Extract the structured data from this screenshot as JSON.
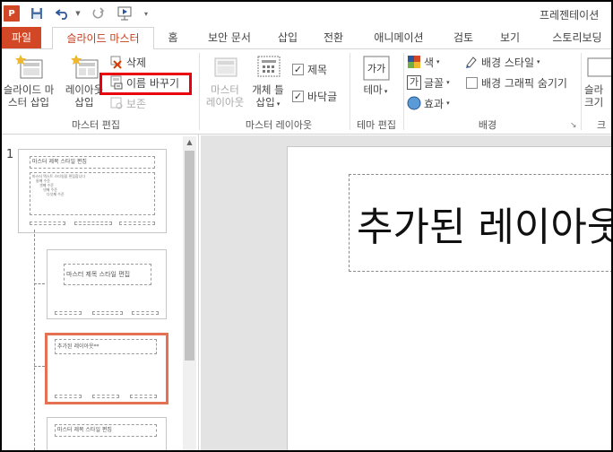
{
  "app": {
    "logo_letter": "P",
    "window_title": "프레젠테이션"
  },
  "tabs": [
    {
      "label": "파일"
    },
    {
      "label": "슬라이드 마스터"
    },
    {
      "label": "홈"
    },
    {
      "label": "보안 문서"
    },
    {
      "label": "삽입"
    },
    {
      "label": "전환"
    },
    {
      "label": "애니메이션"
    },
    {
      "label": "검토"
    },
    {
      "label": "보기"
    },
    {
      "label": "스토리보딩"
    }
  ],
  "ribbon": {
    "master_edit": {
      "insert_master_line1": "슬라이드 마",
      "insert_master_line2": "스터 삽입",
      "insert_layout_line1": "레이아웃",
      "insert_layout_line2": "삽입",
      "delete": "삭제",
      "rename": "이름 바꾸기",
      "preserve": "보존",
      "group_label": "마스터 편집"
    },
    "master_layout": {
      "master_layout_line1": "마스터",
      "master_layout_line2": "레이아웃",
      "placeholder_line1": "개체 틀",
      "placeholder_line2": "삽입",
      "title_check": "제목",
      "footer_check": "바닥글",
      "check_mark": "✓",
      "group_label": "마스터 레이아웃"
    },
    "theme_edit": {
      "themes": "테마",
      "icon_text": "가가",
      "group_label": "테마 편집"
    },
    "background": {
      "colors": "색",
      "fonts": "글꼴",
      "effects": "효과",
      "bg_styles": "배경 스타일",
      "hide_bg": "배경 그래픽 숨기기",
      "group_label": "배경",
      "fonts_icon_glyph": "가"
    },
    "size": {
      "slide_size_line1": "슬라",
      "slide_size_line2": "크기",
      "group_label_partial": "크"
    }
  },
  "thumbnails": {
    "master_number": "1",
    "master": {
      "title": "마스터 제목 스타일 편집",
      "body_lines": [
        "마스터 텍스트 스타일을 편집합니다",
        "둘째 수준",
        "셋째 수준",
        "넷째 수준",
        "다섯째 수준"
      ]
    },
    "layout1_title": "마스터 제목 스타일 편집",
    "layout2_title": "추가된 레이아웃**",
    "layout3_title": "마스터 제목 스타일 편집"
  },
  "canvas": {
    "title_text": "추가된 레이아웃"
  },
  "colors": {
    "accent": "#d24726",
    "highlight": "#e8000e",
    "selected_thumb": "#e47252"
  }
}
